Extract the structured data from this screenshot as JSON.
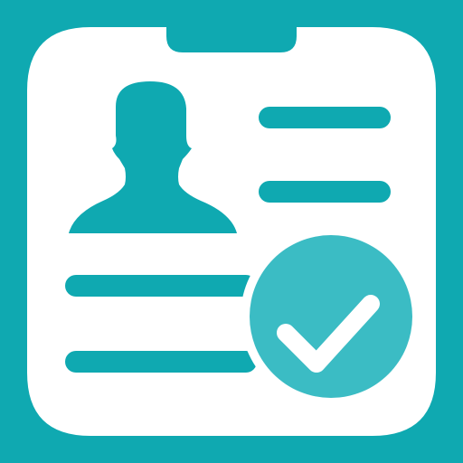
{
  "icon": {
    "name": "profile-card-verified-icon",
    "colors": {
      "background": "#0fa9b1",
      "card": "#ffffff",
      "accent": "#0fa9b1",
      "check_badge": "#3bbcc4",
      "check_mark": "#ffffff"
    },
    "parts": [
      "id-card-icon",
      "person-silhouette-icon",
      "text-line-icon",
      "checkmark-badge-icon"
    ]
  }
}
